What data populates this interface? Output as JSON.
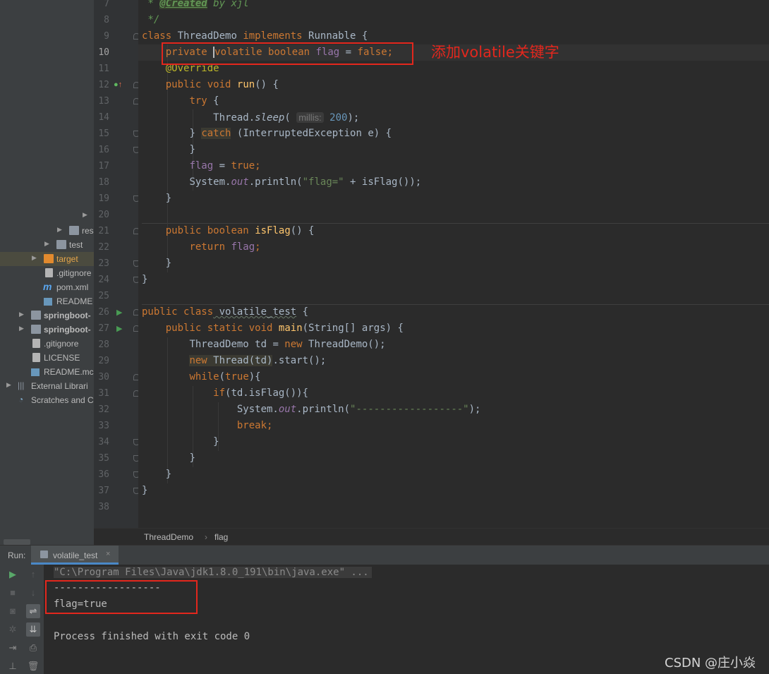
{
  "project_tree": {
    "items": [
      {
        "label": "res",
        "kind": "folder",
        "level": 3
      },
      {
        "label": "test",
        "kind": "folder",
        "level": 2
      },
      {
        "label": "target",
        "kind": "folder",
        "level": 1,
        "selected": true
      },
      {
        "label": ".gitignore",
        "kind": "file",
        "level": 1
      },
      {
        "label": "pom.xml",
        "kind": "maven",
        "level": 1
      },
      {
        "label": "README",
        "kind": "markdown",
        "level": 1
      },
      {
        "label": "springboot-",
        "kind": "module",
        "level": 0
      },
      {
        "label": "springboot-",
        "kind": "module",
        "level": 0
      },
      {
        "label": ".gitignore",
        "kind": "file",
        "level": 0
      },
      {
        "label": "LICENSE",
        "kind": "file",
        "level": 0
      },
      {
        "label": "README.mc",
        "kind": "markdown",
        "level": 0
      },
      {
        "label": "External Librari",
        "kind": "library",
        "level": -1
      },
      {
        "label": "Scratches and C",
        "kind": "scratch",
        "level": -1
      }
    ]
  },
  "editor": {
    "line_numbers": [
      "7",
      "8",
      "9",
      "10",
      "11",
      "12",
      "13",
      "14",
      "15",
      "16",
      "17",
      "18",
      "19",
      "20",
      "21",
      "22",
      "23",
      "24",
      "25",
      "26",
      "27",
      "28",
      "29",
      "30",
      "31",
      "32",
      "33",
      "34",
      "35",
      "36",
      "37",
      "38"
    ],
    "current_line": "10",
    "code": {
      "l7_star": " * ",
      "l7_tag": "@Created",
      "l7_rest": " by xjl",
      "l8": " */",
      "class_kw": "class",
      "class_name": " ThreadDemo ",
      "implements_kw": "implements",
      "iface": " Runnable {",
      "private_kw": "private",
      "volatile_kw": "volatile",
      "boolean_kw": "boolean",
      "flag_field": "flag",
      "assign": " = ",
      "false_kw": "false",
      "semi": ";",
      "override": "@Override",
      "public_kw": "public",
      "void_kw": "void",
      "run_fn": "run",
      "parens_open": "() {",
      "try_kw": "try",
      "brace_open": " {",
      "thread_cls": "Thread.",
      "sleep_fn": "sleep",
      "paren_l": "(",
      "hint_millis": "millis:",
      "num_200": "200",
      "paren_semi": ");",
      "close_brace": "}",
      "catch_kw": "catch",
      "catch_args": " (InterruptedException e) {",
      "true_kw": "true",
      "system_out": "System.",
      "out_fld": "out",
      "println_a": ".println(",
      "str_flag": "\"flag=\"",
      "plus_isflag": " + isFlag());",
      "isflag_fn": "isFlag",
      "return_kw": "return",
      "class2_name": " volatile_test",
      "static_kw": "static",
      "main_fn": "main",
      "main_args": "(String[] args) {",
      "td_decl": "ThreadDemo td = ",
      "new_kw": "new",
      "td_ctor": " ThreadDemo();",
      "thread_td": " Thread(td)",
      "start_call": ".start();",
      "while_kw": "while",
      "while_true_close": "){",
      "if_kw": "if",
      "if_cond": "(td.isFlag()){",
      "str_dashes": "\"------------------\"",
      "break_kw": "break"
    },
    "annotation_text": "添加volatile关键字"
  },
  "breadcrumb": {
    "class": "ThreadDemo",
    "sep": "›",
    "member": "flag"
  },
  "run_panel": {
    "label": "Run:",
    "tab": "volatile_test",
    "tab_close": "×",
    "command": "\"C:\\Program Files\\Java\\jdk1.8.0_191\\bin\\java.exe\" ...",
    "output": [
      "------------------",
      "flag=true",
      "",
      "Process finished with exit code 0"
    ]
  },
  "watermark": "CSDN @庄小焱"
}
